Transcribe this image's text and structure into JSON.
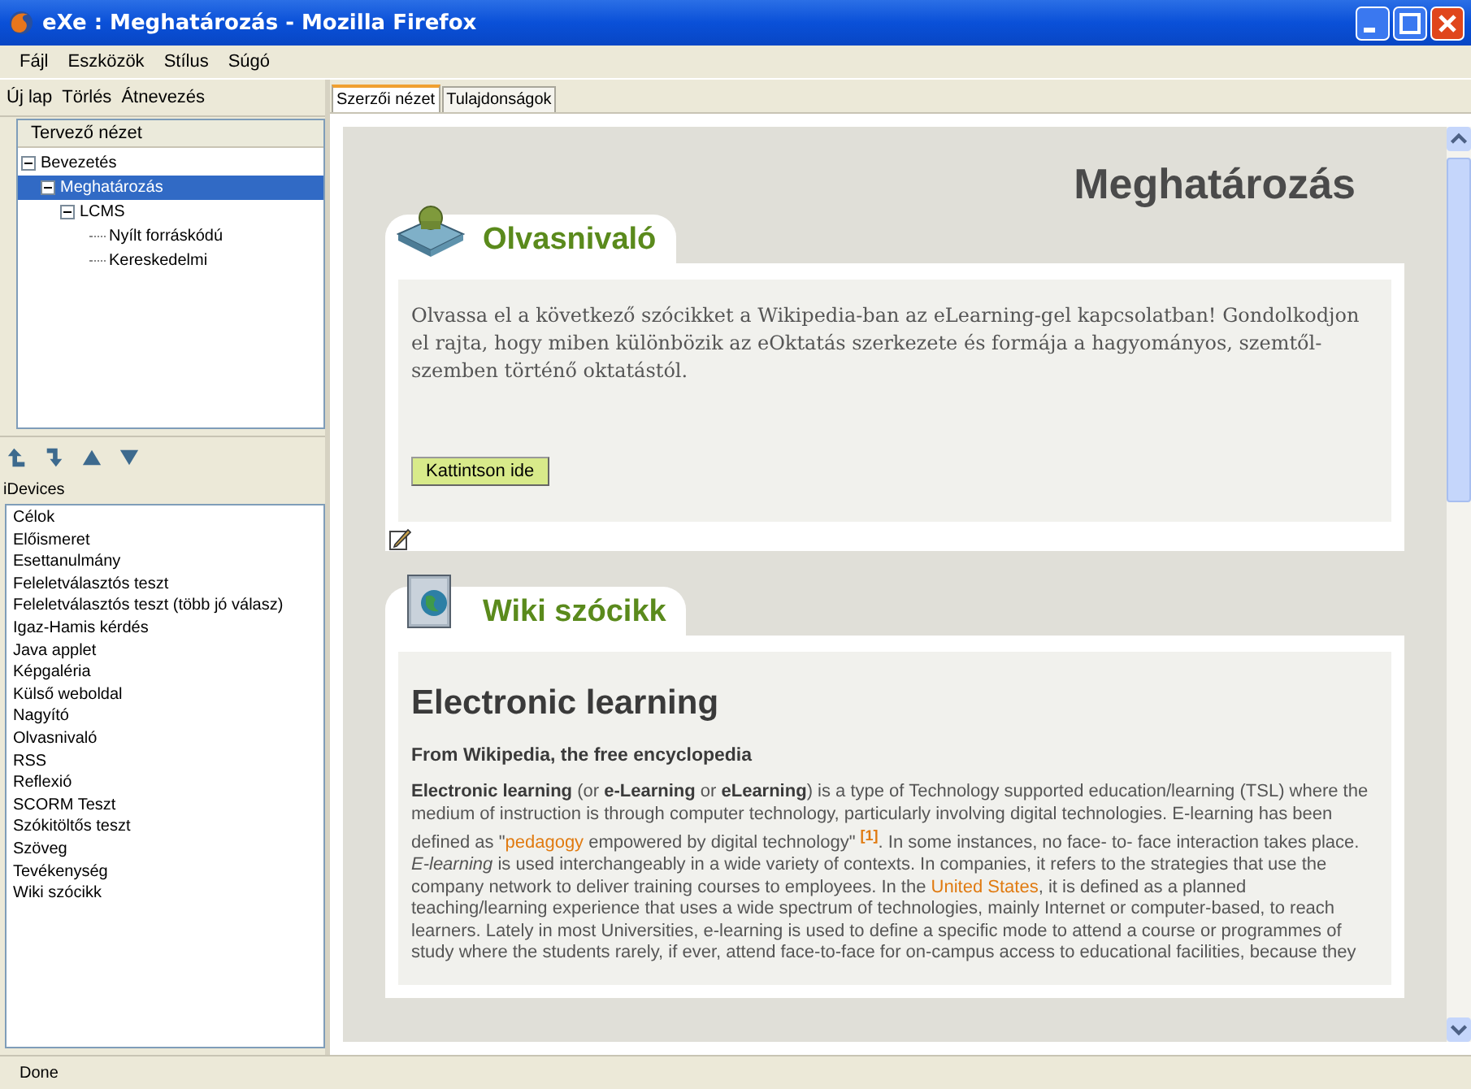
{
  "window": {
    "title": "eXe : Meghatározás - Mozilla Firefox"
  },
  "menu": [
    "Fájl",
    "Eszközök",
    "Stílus",
    "Súgó"
  ],
  "outline_toolbar": [
    "Új lap",
    "Törlés",
    "Átnevezés"
  ],
  "outline": {
    "title": "Tervező nézet",
    "items": [
      {
        "label": "Bevezetés",
        "expanded": true,
        "selected": false,
        "children": [
          {
            "label": "Meghatározás",
            "expanded": true,
            "selected": true,
            "children": [
              {
                "label": "LCMS",
                "expanded": true,
                "selected": false,
                "children": [
                  {
                    "label": "Nyílt forráskódú",
                    "selected": false
                  },
                  {
                    "label": "Kereskedelmi",
                    "selected": false
                  }
                ]
              }
            ]
          }
        ]
      }
    ]
  },
  "idevices": {
    "title": "iDevices",
    "items": [
      "Célok",
      "Előismeret",
      "Esettanulmány",
      "Feleletválasztós teszt",
      "Feleletválasztós teszt (több jó válasz)",
      "Igaz-Hamis kérdés",
      "Java applet",
      "Képgaléria",
      "Külső weboldal",
      "Nagyító",
      "Olvasnivaló",
      "RSS",
      "Reflexió",
      "SCORM Teszt",
      "Szókitöltős teszt",
      "Szöveg",
      "Tevékenység",
      "Wiki szócikk"
    ]
  },
  "tabs": [
    {
      "label": "Szerzői nézet",
      "selected": true
    },
    {
      "label": "Tulajdonságok",
      "selected": false
    }
  ],
  "page": {
    "title": "Meghatározás",
    "idevices": [
      {
        "kind": "reading",
        "title": "Olvasnivaló",
        "text": "Olvassa el a következő szócikket a Wikipedia-ban az eLearning-gel kapcsolatban! Gondolkodjon el rajta, hogy miben különbözik az eOktatás szerkezete és formája a hagyományos, szemtől-szemben történő oktatástól.",
        "button": "Kattintson ide"
      },
      {
        "kind": "wiki",
        "title": "Wiki szócikk",
        "article": {
          "heading": "Electronic learning",
          "subheading": "From Wikipedia, the free encyclopedia",
          "paragraph": [
            {
              "kind": "text",
              "text": "**Electronic learning** (or **e-Learning** or **eLearning**) is a type of Technology supported education/learning (TSL) where the medium of instruction is through computer technology, particularly involving digital technologies. E-learning has been defined as \""
            },
            {
              "kind": "link",
              "text": "pedagogy"
            },
            {
              "kind": "text",
              "text": " empowered by digital technology\" "
            },
            {
              "kind": "footnote",
              "text": "[1]"
            },
            {
              "kind": "text",
              "text": ". In some instances, no face- to- face interaction takes place. *E-learning* is used interchangeably in a wide variety of contexts. In companies, it refers to the strategies that use the company network to deliver training courses to employees. In the "
            },
            {
              "kind": "link",
              "text": "United States"
            },
            {
              "kind": "text",
              "text": ", it is defined as a planned teaching/learning experience that uses a wide spectrum of technologies, mainly Internet or computer-based, to reach learners. Lately in most Universities, e-learning is used to define a specific mode to attend a course or programmes of study where the students rarely, if ever, attend face-to-face for on-campus access to educational facilities, because they"
            }
          ]
        }
      }
    ]
  },
  "status_bar": "Done"
}
